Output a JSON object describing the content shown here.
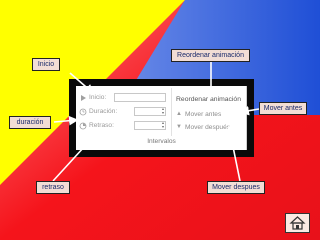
{
  "callouts": {
    "inicio": "Inicio",
    "duracion": "duración",
    "retraso": "retraso",
    "reordenar": "Reordenar animación",
    "mover_antes": "Mover antes",
    "mover_despues": "Mover despues"
  },
  "panel": {
    "inicio_label": "Inicio:",
    "duracion_label": "Duración:",
    "retraso_label": "Retraso:",
    "reordenar_title": "Reordenar animación",
    "mover_antes_label": "Mover antes",
    "mover_despues_label": "Mover después",
    "group_label": "Intervalos"
  },
  "icons": {
    "inicio": "play-icon",
    "duracion": "clock-icon",
    "retraso": "delay-icon",
    "home": "home-icon"
  },
  "colors": {
    "background_yellow": "#ffff00",
    "background_blue": "#1f4fd6",
    "background_red": "#f5141b",
    "callout_fill": "#f2ddd5",
    "callout_text": "#1a2a6b"
  }
}
